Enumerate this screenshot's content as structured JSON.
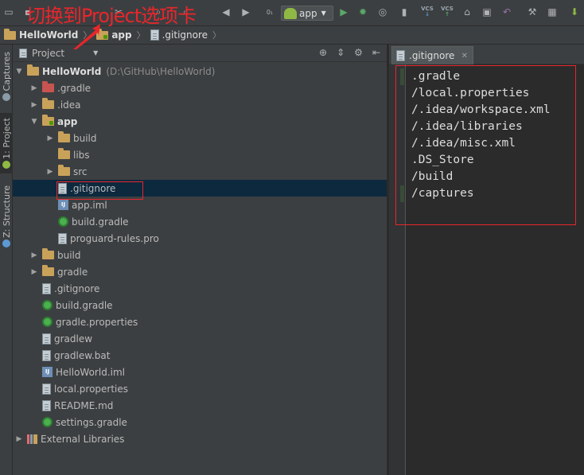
{
  "annotation": {
    "text": "切换到Project选项卡",
    "color": "#e8262c"
  },
  "toolbar": {
    "run_config_label": "app",
    "vcs_label": "VCS"
  },
  "breadcrumb": {
    "items": [
      {
        "label": "HelloWorld"
      },
      {
        "label": "app"
      },
      {
        "label": ".gitignore"
      }
    ]
  },
  "sidebar": {
    "tabs": [
      {
        "label": "Captures"
      },
      {
        "label": "1: Project"
      },
      {
        "label": "Z: Structure"
      }
    ]
  },
  "project_panel": {
    "view_label": "Project",
    "tree": [
      {
        "label": "HelloWorld",
        "path": "(D:\\GitHub\\HelloWorld)"
      },
      {
        "label": ".gradle"
      },
      {
        "label": ".idea"
      },
      {
        "label": "app"
      },
      {
        "label": "build"
      },
      {
        "label": "libs"
      },
      {
        "label": "src"
      },
      {
        "label": ".gitignore"
      },
      {
        "label": "app.iml"
      },
      {
        "label": "build.gradle"
      },
      {
        "label": "proguard-rules.pro"
      },
      {
        "label": "build"
      },
      {
        "label": "gradle"
      },
      {
        "label": ".gitignore"
      },
      {
        "label": "build.gradle"
      },
      {
        "label": "gradle.properties"
      },
      {
        "label": "gradlew"
      },
      {
        "label": "gradlew.bat"
      },
      {
        "label": "HelloWorld.iml"
      },
      {
        "label": "local.properties"
      },
      {
        "label": "README.md"
      },
      {
        "label": "settings.gradle"
      },
      {
        "label": "External Libraries"
      }
    ]
  },
  "editor": {
    "tab_label": ".gitignore",
    "lines": [
      ".gradle",
      "/local.properties",
      "/.idea/workspace.xml",
      "/.idea/libraries",
      "/.idea/misc.xml",
      ".DS_Store",
      "/build",
      "/captures"
    ]
  },
  "colors": {
    "annotation_red": "#e8262c",
    "selection": "#0d293e",
    "panel_bg": "#3c3f41",
    "editor_bg": "#2b2b2b"
  }
}
